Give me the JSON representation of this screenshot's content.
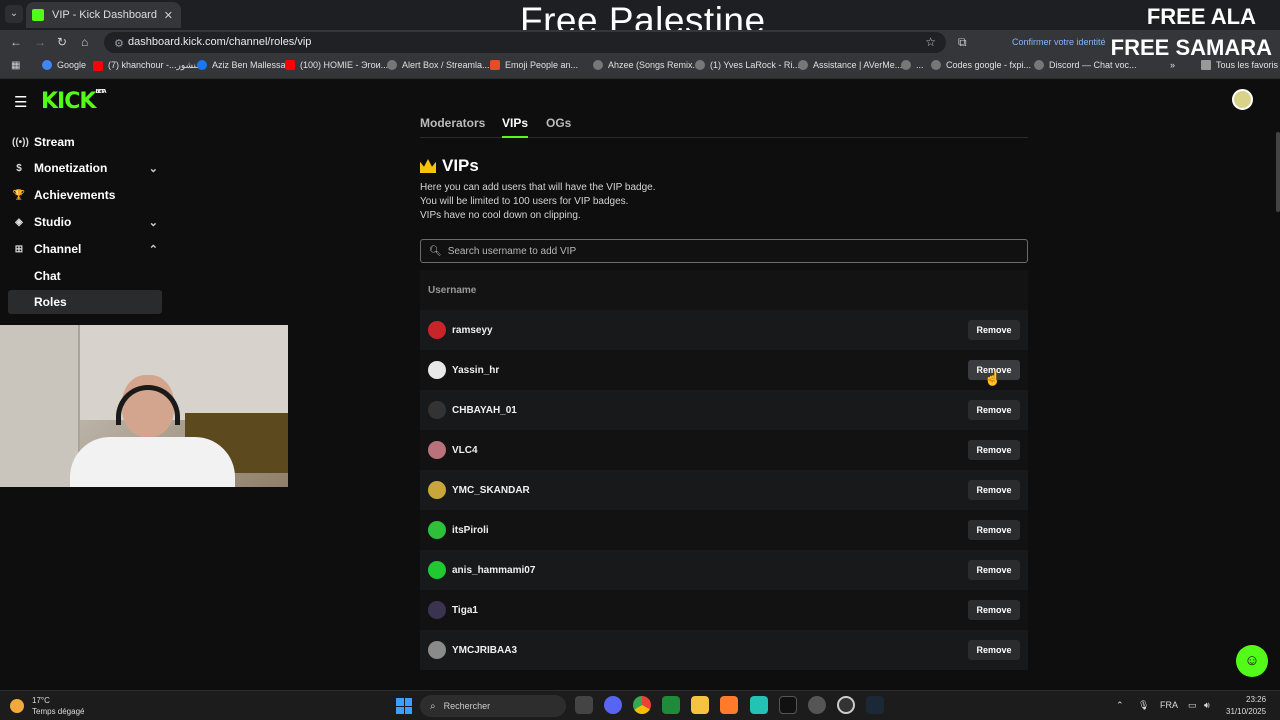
{
  "browser": {
    "tab_title": "VIP - Kick Dashboard",
    "url": "dashboard.kick.com/channel/roles/vip",
    "confirm_text": "Confirmer votre identité",
    "bookmarks": [
      {
        "label": "Google",
        "color": "#4285f4"
      },
      {
        "label": "(7) khanchour -...خنشور",
        "color": "#ff0000"
      },
      {
        "label": "Aziz Ben Mallessa",
        "color": "#1877f2"
      },
      {
        "label": "(100) HOMIE - Эгои...",
        "color": "#ff0000"
      },
      {
        "label": "Alert Box / Streamla...",
        "color": "#888888"
      },
      {
        "label": "Emoji People an...",
        "color": "#e44d26"
      },
      {
        "label": "Ahzee (Songs Remix...",
        "color": "#888888"
      },
      {
        "label": "(1) Yves LaRock - Ri...",
        "color": "#888888"
      },
      {
        "label": "Assistance | AVerMe...",
        "color": "#888888"
      },
      {
        "label": "...",
        "color": "#888888"
      },
      {
        "label": "Codes google - fxpi...",
        "color": "#888888"
      },
      {
        "label": "Discord — Chat voc...",
        "color": "#888888"
      }
    ],
    "all_bookmarks": "Tous les favoris"
  },
  "overlay": {
    "title": "Free Palestine",
    "line1": "FREE ALA",
    "line2": "FREE SAMARA"
  },
  "header": {
    "logo": "KICK",
    "logo_badge": "BETA"
  },
  "sidebar": {
    "items": [
      {
        "label": "Stream",
        "icon": "broadcast-icon"
      },
      {
        "label": "Monetization",
        "icon": "dollar-icon"
      },
      {
        "label": "Achievements",
        "icon": "trophy-icon"
      },
      {
        "label": "Studio",
        "icon": "studio-icon"
      },
      {
        "label": "Channel",
        "icon": "channel-icon"
      }
    ],
    "sub_items": [
      "Chat",
      "Roles"
    ]
  },
  "main": {
    "tabs": [
      "Moderators",
      "VIPs",
      "OGs"
    ],
    "title": "VIPs",
    "description": [
      "Here you can add users that will have the VIP badge.",
      "You will be limited to 100 users for VIP badges.",
      "VIPs have no cool down on clipping."
    ],
    "search_placeholder": "Search username to add VIP",
    "column_header": "Username",
    "remove_label": "Remove",
    "users": [
      {
        "name": "ramseyy",
        "avatar_color": "#c8252b"
      },
      {
        "name": "Yassin_hr",
        "avatar_color": "#e8e8e8"
      },
      {
        "name": "CHBAYAH_01",
        "avatar_color": "#333333"
      },
      {
        "name": "VLC4",
        "avatar_color": "#b9727a"
      },
      {
        "name": "YMC_SKANDAR",
        "avatar_color": "#c9a63c"
      },
      {
        "name": "itsPiroli",
        "avatar_color": "#2fbf3a"
      },
      {
        "name": "anis_hammami07",
        "avatar_color": "#22c832"
      },
      {
        "name": "Tiga1",
        "avatar_color": "#3a3450"
      },
      {
        "name": "YMCJRIBAA3",
        "avatar_color": "#8a8a8a"
      }
    ]
  },
  "taskbar": {
    "temp": "17°C",
    "weather": "Temps dégagé",
    "search": "Rechercher",
    "lang": "FRA",
    "time": "23:26",
    "date": "31/10/2025"
  }
}
